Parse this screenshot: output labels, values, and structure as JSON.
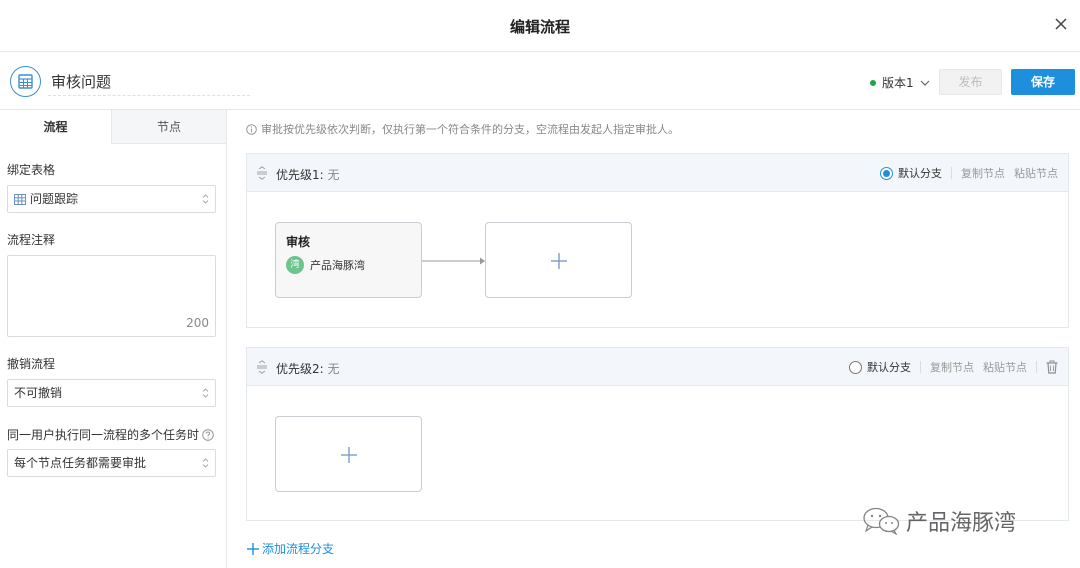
{
  "modal": {
    "title": "编辑流程"
  },
  "toolbar": {
    "form_name": "审核问题",
    "version_label": "版本1",
    "publish_label": "发布",
    "save_label": "保存"
  },
  "left_panel": {
    "tabs": [
      {
        "label": "流程",
        "active": true
      },
      {
        "label": "节点",
        "active": false
      }
    ],
    "bind_form_label": "绑定表格",
    "bind_form_value": "问题跟踪",
    "flow_note_label": "流程注释",
    "flow_note_value": "",
    "flow_note_max": "200",
    "revoke_label": "撤销流程",
    "revoke_value": "不可撤销",
    "multi_task_label": "同一用户执行同一流程的多个任务时",
    "multi_task_value": "每个节点任务都需要审批"
  },
  "main": {
    "info_text": "审批按优先级依次判断，仅执行第一个符合条件的分支，空流程由发起人指定审批人。",
    "branches": [
      {
        "title": "优先级1:",
        "condition": "无",
        "default_label": "默认分支",
        "default_selected": true,
        "copy_label": "复制节点",
        "paste_label": "粘贴节点",
        "nodes": [
          {
            "title": "审核",
            "avatar_text": "湾",
            "assignee": "产品海豚湾"
          }
        ]
      },
      {
        "title": "优先级2:",
        "condition": "无",
        "default_label": "默认分支",
        "default_selected": false,
        "copy_label": "复制节点",
        "paste_label": "粘贴节点",
        "nodes": []
      }
    ],
    "add_branch_label": "添加流程分支"
  },
  "watermark": {
    "text": "产品海豚湾"
  },
  "colors": {
    "accent": "#1e8fdc",
    "status_dot": "#21a34a",
    "avatar": "#6dc48d"
  }
}
